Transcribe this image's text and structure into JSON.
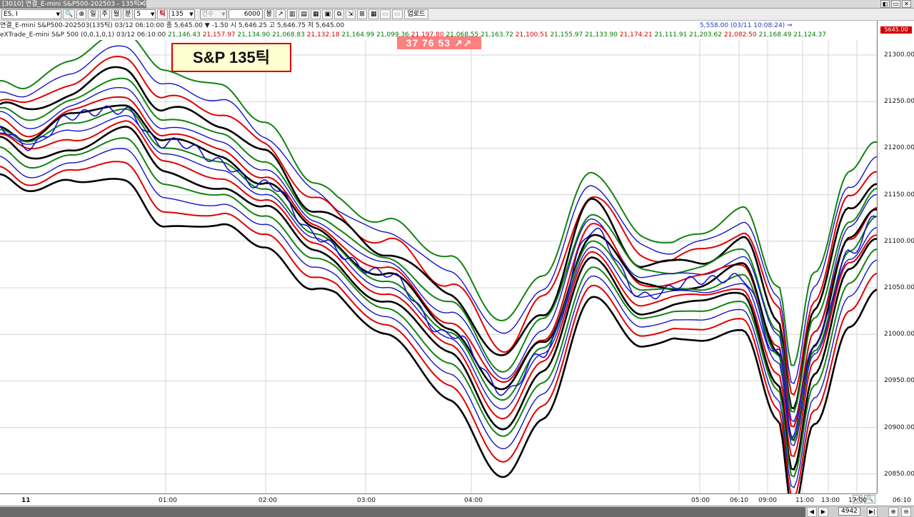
{
  "window": {
    "tab_title": "[3010] 연결_E-mini S&P500-202503 - 135틱 수수",
    "close_glyph": "✕",
    "controls": [
      "◧",
      "▭",
      "✕"
    ]
  },
  "toolbar": {
    "symbol": "ES, I",
    "period_buttons": [
      "일",
      "주",
      "월",
      "분"
    ],
    "minute_value": "5",
    "tick_label": "틱",
    "tick_value": "135",
    "count_label": "건수",
    "count_value": "6000",
    "count_unit": "봉",
    "upload_label": "업로드"
  },
  "info": {
    "line1": "연결_E-mini S&P500-202503(135틱) 03/12 06:10:00   종 5,645.00 ▼ -1.50   시 5,646.25  고 5,646.75  저 5,645.00",
    "line1_right": "5,558.00 (03/11 10:08:24)  ⇒",
    "line2_prefix": "eXTrade_E-mini S&P 500  (0,0,1,0,1) 03/12 06:10:00",
    "line2_values": [
      "21,146.43",
      "21,157.97",
      "21,134.90",
      "21,068.83",
      "21,132.18",
      "21,164.99",
      "21,099.36",
      "21,197.80",
      "21,068.55",
      "21,163.72",
      "21,100.51",
      "21,155.97",
      "21,133.90",
      "21,174.21",
      "21,111.91",
      "21,203.62",
      "21,082.50",
      "21,168.49",
      "21,124.37"
    ]
  },
  "annotation": "S&P 135틱",
  "signal": "37  76  53 ↗↗",
  "yaxis": {
    "labels": [
      "21300.00",
      "21250.00",
      "21200.00",
      "21150.00",
      "21100.00",
      "21050.00",
      "21000.00",
      "20950.00",
      "20900.00",
      "20850.00"
    ],
    "price_tag": "5645.00"
  },
  "xaxis": {
    "labels": [
      "11",
      "01:00",
      "02:00",
      "03:00",
      "04:00",
      "05:00",
      "06:10",
      "09:00",
      "11:00",
      "13:00",
      "17:00",
      "06:10"
    ]
  },
  "scrollbar": {
    "count": "4942"
  },
  "colors": {
    "grid": "#d4d4d4",
    "green": "#128212",
    "red": "#e00000",
    "blue": "#1414c8",
    "black": "#000000"
  }
}
